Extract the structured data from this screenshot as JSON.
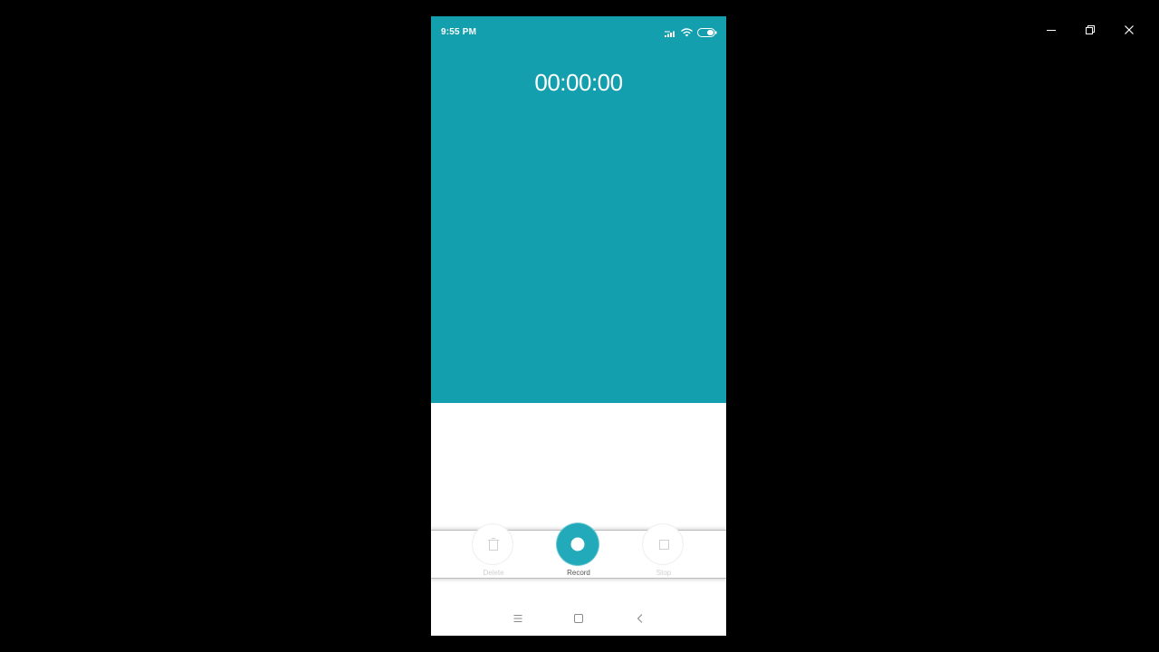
{
  "window": {
    "controls": {
      "minimize_icon": "minimize-icon",
      "restore_icon": "restore-icon",
      "close_icon": "close-icon"
    }
  },
  "status_bar": {
    "time": "9:55 PM",
    "icons": [
      "signal-icon",
      "wifi-icon",
      "battery-icon"
    ]
  },
  "recorder": {
    "timer": "00:00:00",
    "controls": {
      "delete_label": "Delete",
      "record_label": "Record",
      "stop_label": "Stop"
    }
  },
  "nav_bar": {
    "icons": [
      "menu-icon",
      "home-icon",
      "back-icon"
    ]
  },
  "colors": {
    "accent": "#149faf",
    "record_button": "#22aabb",
    "background": "#000000",
    "panel": "#ffffff"
  }
}
